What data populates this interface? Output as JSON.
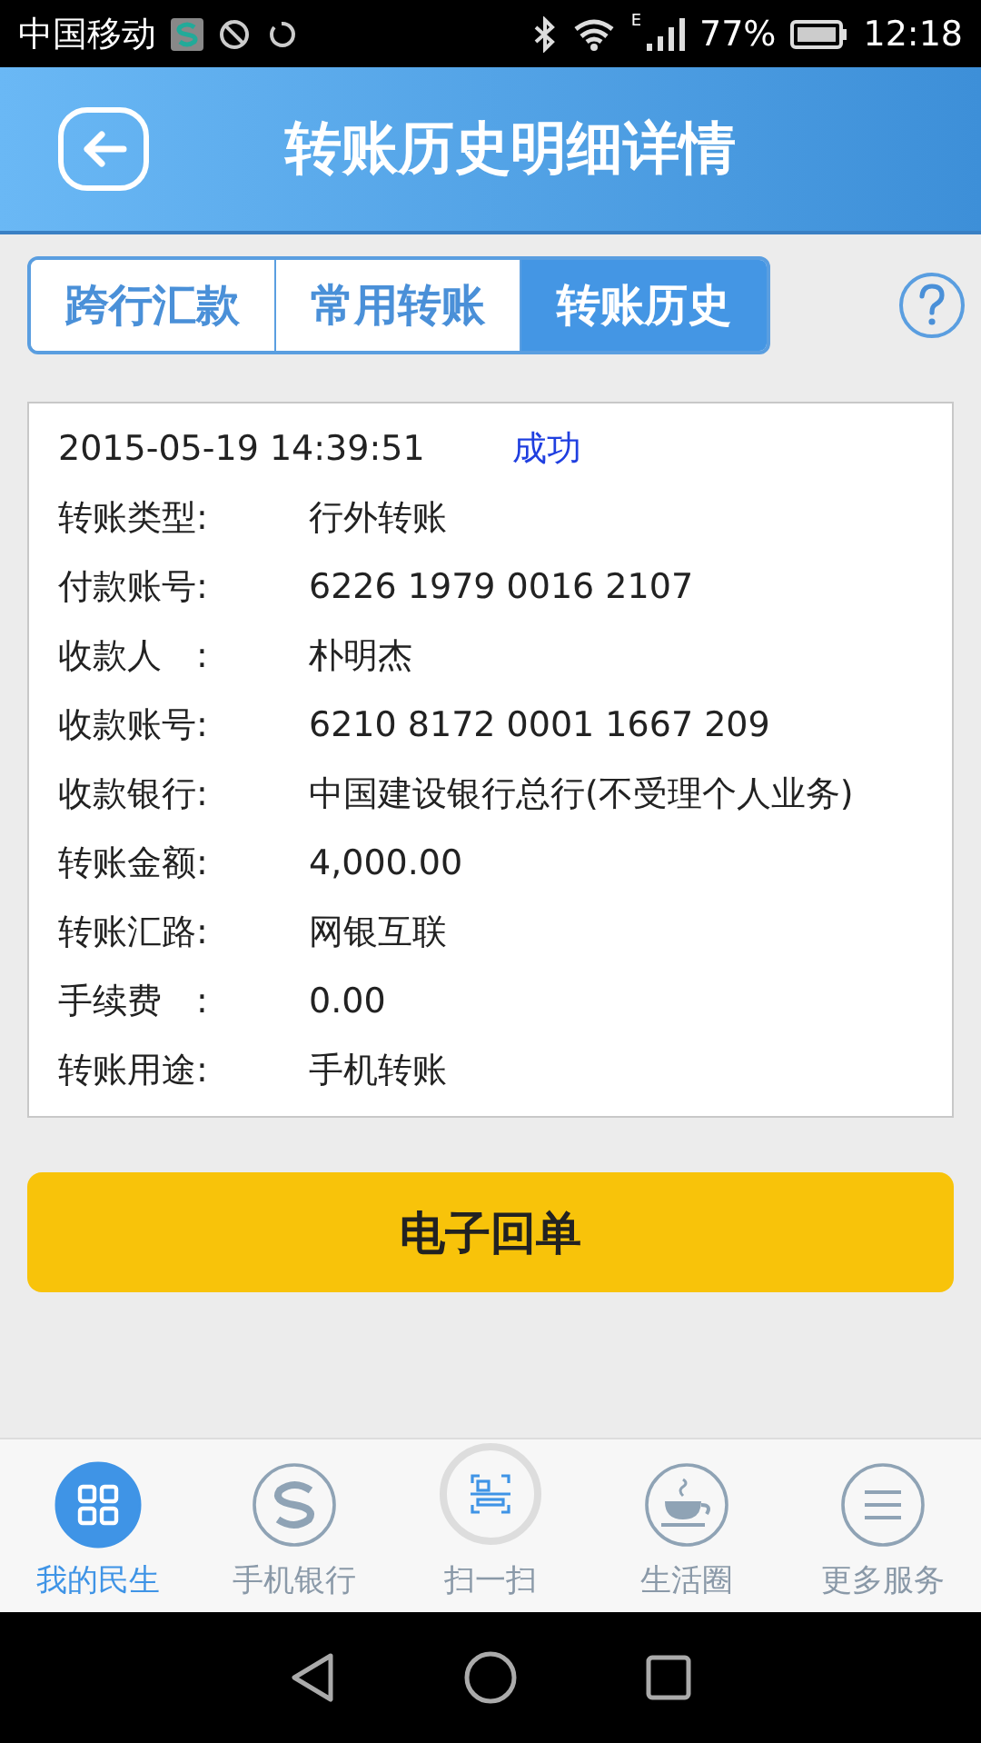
{
  "status_bar": {
    "carrier": "中国移动",
    "battery": "77%",
    "time": "12:18",
    "network": "E"
  },
  "header": {
    "title": "转账历史明细详情"
  },
  "tabs": [
    {
      "label": "跨行汇款",
      "selected": false
    },
    {
      "label": "常用转账",
      "selected": false
    },
    {
      "label": "转账历史",
      "selected": true
    }
  ],
  "detail": {
    "datetime": "2015-05-19 14:39:51",
    "status": "成功",
    "rows": [
      {
        "label": "转账类型:",
        "value": "行外转账"
      },
      {
        "label": "付款账号:",
        "value": "6226 1979 0016 2107"
      },
      {
        "label": "收款人　:",
        "value": "朴明杰"
      },
      {
        "label": "收款账号:",
        "value": "6210 8172 0001 1667 209"
      },
      {
        "label": "收款银行:",
        "value": "中国建设银行总行(不受理个人业务)"
      },
      {
        "label": "转账金额:",
        "value": "4,000.00"
      },
      {
        "label": "转账汇路:",
        "value": "网银互联"
      },
      {
        "label": "手续费　:",
        "value": "0.00"
      },
      {
        "label": "转账用途:",
        "value": "手机转账"
      }
    ]
  },
  "receipt_button": "电子回单",
  "bottom_nav": [
    {
      "label": "我的民生",
      "selected": true
    },
    {
      "label": "手机银行",
      "selected": false
    },
    {
      "label": "扫一扫",
      "selected": false
    },
    {
      "label": "生活圈",
      "selected": false
    },
    {
      "label": "更多服务",
      "selected": false
    }
  ]
}
